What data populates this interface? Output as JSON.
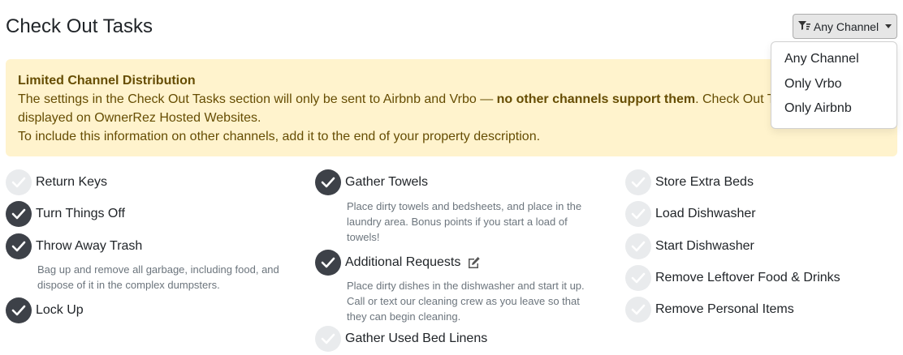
{
  "header": {
    "title": "Check Out Tasks",
    "channel_button_label": "Any Channel"
  },
  "dropdown": {
    "options": [
      "Any Channel",
      "Only Vrbo",
      "Only Airbnb"
    ]
  },
  "alert": {
    "title": "Limited Channel Distribution",
    "line1_prefix": "The settings in the Check Out Tasks section will only be sent to Airbnb and Vrbo — ",
    "line1_bold": "no other channels support them",
    "line1_suffix": ". Check Out Tas",
    "line2": "displayed on OwnerRez Hosted Websites.",
    "line3": "To include this information on other channels, add it to the end of your property description."
  },
  "tasks": {
    "col1": [
      {
        "label": "Return Keys",
        "checked": false
      },
      {
        "label": "Turn Things Off",
        "checked": true
      },
      {
        "label": "Throw Away Trash",
        "checked": true,
        "description": "Bag up and remove all garbage, including food, and dispose of it in the complex dumpsters."
      },
      {
        "label": "Lock Up",
        "checked": true
      }
    ],
    "col2": [
      {
        "label": "Gather Towels",
        "checked": true,
        "description": "Place dirty towels and bedsheets, and place in the laundry area. Bonus points if you start a load of towels!"
      },
      {
        "label": "Additional Requests",
        "checked": true,
        "description": "Place dirty dishes in the dishwasher and start it up. Call or text our cleaning crew as you leave so that they can begin cleaning."
      },
      {
        "label": "Gather Used Bed Linens",
        "checked": false
      }
    ],
    "col3": [
      {
        "label": "Store Extra Beds",
        "checked": false
      },
      {
        "label": "Load Dishwasher",
        "checked": false
      },
      {
        "label": "Start Dishwasher",
        "checked": false
      },
      {
        "label": "Remove Leftover Food & Drinks",
        "checked": false
      },
      {
        "label": "Remove Personal Items",
        "checked": false
      }
    ]
  },
  "colors": {
    "checked": "#3d4148",
    "unchecked": "#e9ebed",
    "alert_bg": "#fff3cd",
    "alert_text": "#664d03"
  },
  "icons": {
    "channel_button": "filter-icon",
    "check": "checkmark-icon",
    "edit": "edit-icon"
  }
}
